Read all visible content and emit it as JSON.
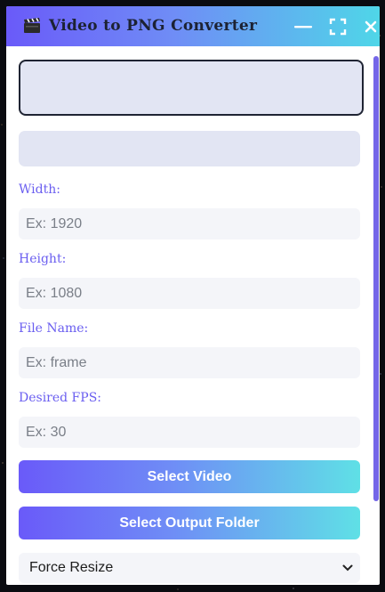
{
  "window": {
    "title": "Video to PNG Converter",
    "icons": {
      "app": "clapperboard-icon",
      "minimize": "minimize-icon",
      "maximize": "fullscreen-icon",
      "close": "close-icon"
    }
  },
  "form": {
    "width": {
      "label": "Width:",
      "placeholder": "Ex: 1920",
      "value": ""
    },
    "height": {
      "label": "Height:",
      "placeholder": "Ex: 1080",
      "value": ""
    },
    "file_name": {
      "label": "File Name:",
      "placeholder": "Ex: frame",
      "value": ""
    },
    "fps": {
      "label": "Desired FPS:",
      "placeholder": "Ex: 30",
      "value": ""
    }
  },
  "buttons": {
    "select_video": "Select Video",
    "select_output": "Select Output Folder"
  },
  "resize_select": {
    "selected": "Force Resize",
    "icon": "chevron-down-icon"
  },
  "colors": {
    "gradient_start": "#6a5af9",
    "gradient_end": "#4fd6e8",
    "label": "#6a5ef0",
    "field_bg": "#f4f5f9",
    "panel_bg": "#e2e5f3"
  }
}
